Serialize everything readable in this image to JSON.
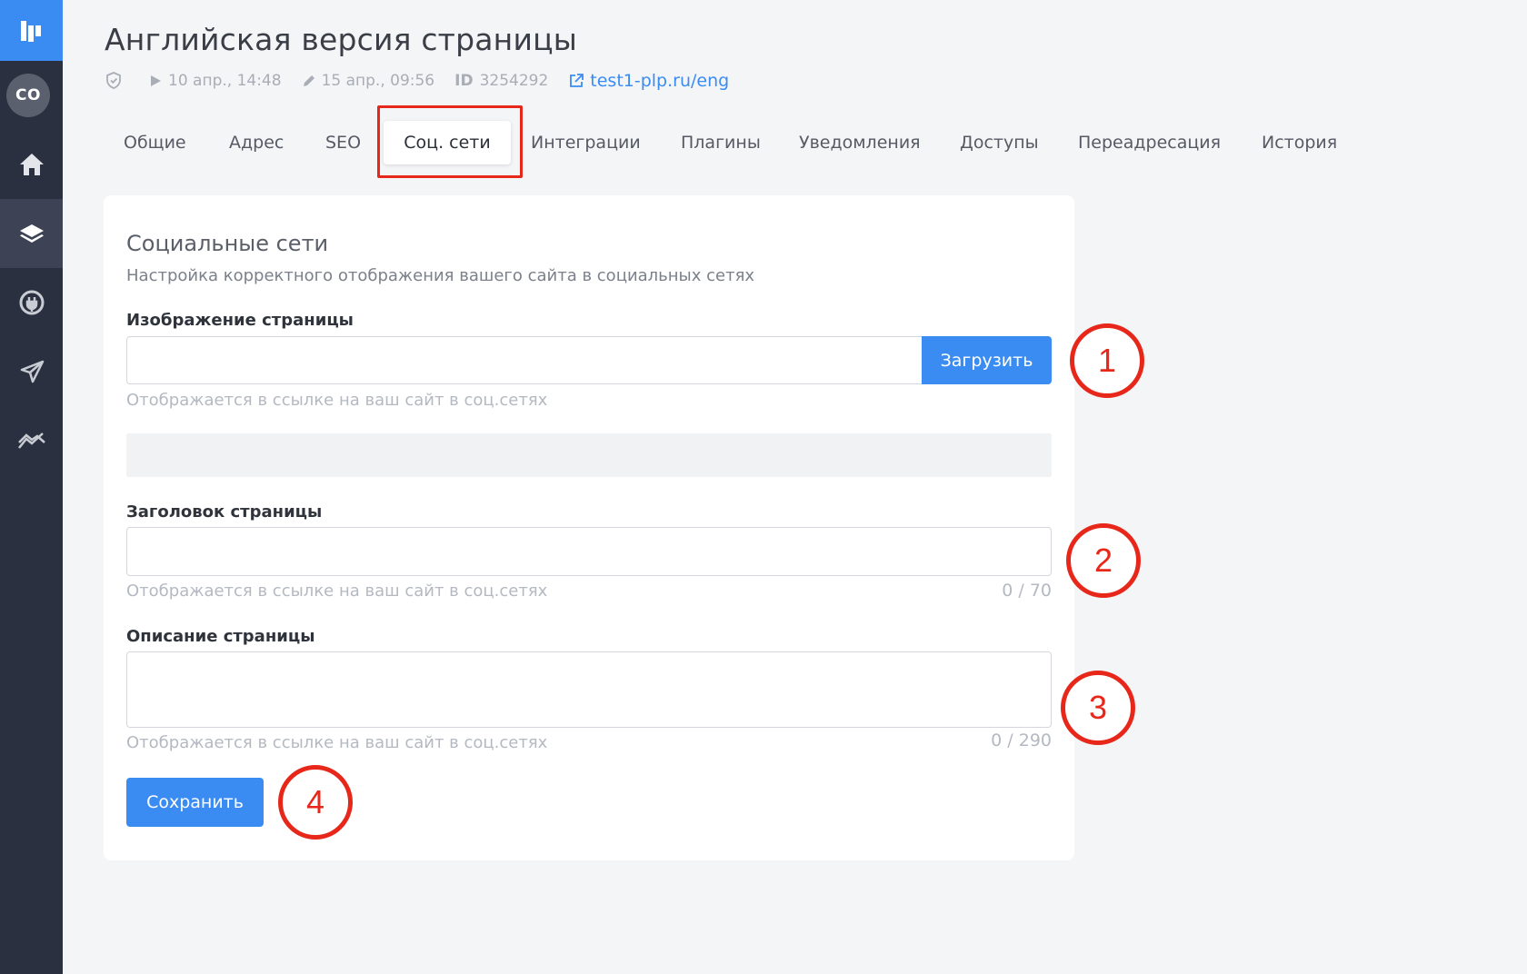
{
  "page": {
    "title": "Английская версия страницы",
    "meta": {
      "published": "10 апр., 14:48",
      "edited": "15 апр., 09:56",
      "id_label": "ID",
      "id_value": "3254292",
      "link": "test1-plp.ru/eng"
    }
  },
  "sidebar": {
    "avatar_initials": "CO",
    "icons": [
      "home-icon",
      "layers-icon",
      "plug-icon",
      "send-icon",
      "analytics-icon"
    ]
  },
  "tabs": [
    {
      "label": "Общие"
    },
    {
      "label": "Адрес"
    },
    {
      "label": "SEO"
    },
    {
      "label": "Соц. сети",
      "active": true
    },
    {
      "label": "Интеграции"
    },
    {
      "label": "Плагины"
    },
    {
      "label": "Уведомления"
    },
    {
      "label": "Доступы"
    },
    {
      "label": "Переадресация"
    },
    {
      "label": "История"
    }
  ],
  "form": {
    "section_title": "Социальные сети",
    "section_subtitle": "Настройка корректного отображения вашего сайта в социальных сетях",
    "image": {
      "label": "Изображение страницы",
      "value": "",
      "button": "Загрузить",
      "hint": "Отображается в ссылке на ваш сайт в соц.сетях"
    },
    "title_field": {
      "label": "Заголовок страницы",
      "value": "",
      "hint": "Отображается в ссылке на ваш сайт в соц.сетях",
      "counter": "0 / 70"
    },
    "description_field": {
      "label": "Описание страницы",
      "value": "",
      "hint": "Отображается в ссылке на ваш сайт в соц.сетях",
      "counter": "0 / 290"
    },
    "save_button": "Сохранить"
  },
  "annotations": {
    "c1": "1",
    "c2": "2",
    "c3": "3",
    "c4": "4",
    "color": "#e8271b"
  },
  "colors": {
    "accent": "#3a8cf2",
    "sidebar": "#2b3040"
  }
}
